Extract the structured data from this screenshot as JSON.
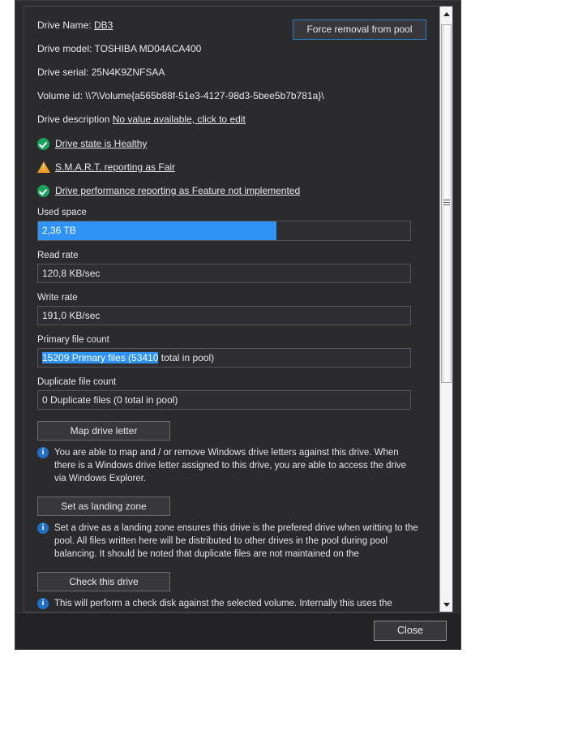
{
  "window": {
    "force_removal_label": "Force removal from pool",
    "close_label": "Close"
  },
  "details": {
    "drive_name_label": "Drive Name: ",
    "drive_name_value": "DB3",
    "drive_model_label": "Drive model: ",
    "drive_model_value": "TOSHIBA MD04ACA400",
    "drive_serial_label": "Drive serial: ",
    "drive_serial_value": "25N4K9ZNFSAA",
    "volume_id_label": "Volume id: ",
    "volume_id_value": "\\\\?\\Volume{a565b88f-51e3-4127-98d3-5bee5b7b781a}\\",
    "drive_description_label": "Drive description ",
    "drive_description_value": "No value available, click to edit"
  },
  "status": [
    {
      "icon": "check-circle-icon",
      "severity": "ok",
      "text": "Drive state is Healthy"
    },
    {
      "icon": "warning-triangle-icon",
      "severity": "warn",
      "text": "S.M.A.R.T. reporting as Fair"
    },
    {
      "icon": "check-circle-icon",
      "severity": "ok",
      "text": "Drive performance reporting as Feature not implemented"
    }
  ],
  "used_space": {
    "label": "Used space",
    "value": "2,36 TB",
    "fill_percent": 64
  },
  "read_rate": {
    "label": "Read rate",
    "value": "120,8 KB/sec"
  },
  "write_rate": {
    "label": "Write rate",
    "value": "191,0 KB/sec"
  },
  "primary_file_count": {
    "label": "Primary file count",
    "selected_text": "15209 Primary files (53410",
    "rest_text": " total in pool)"
  },
  "duplicate_file_count": {
    "label": "Duplicate file count",
    "value": "0 Duplicate files (0 total in pool)"
  },
  "actions": [
    {
      "button_label": "Map drive letter",
      "info": "You are able to map and / or remove Windows drive letters against this drive. When there is a Windows drive letter assigned to this drive, you are able to access the drive via Windows Explorer."
    },
    {
      "button_label": "Set as landing zone",
      "info": "Set a drive as a landing zone ensures this drive is the prefered drive when writting to the pool. All files written here will be distributed to other drives in the pool during pool balancing. It should be noted that duplicate files are not maintained on the"
    },
    {
      "button_label": "Check this drive",
      "info": "This will perform a check disk against the selected volume. Internally this uses the"
    }
  ],
  "scrollbar": {
    "up_arrow": "scroll-up-arrow",
    "down_arrow": "scroll-down-arrow"
  },
  "chart_data": {
    "type": "bar",
    "title": "Used space",
    "categories": [
      "Used space"
    ],
    "values": [
      64
    ],
    "value_labels": [
      "2,36 TB"
    ],
    "ylim": [
      0,
      100
    ],
    "xlabel": "",
    "ylabel": "",
    "grid": false,
    "legend": "none"
  }
}
